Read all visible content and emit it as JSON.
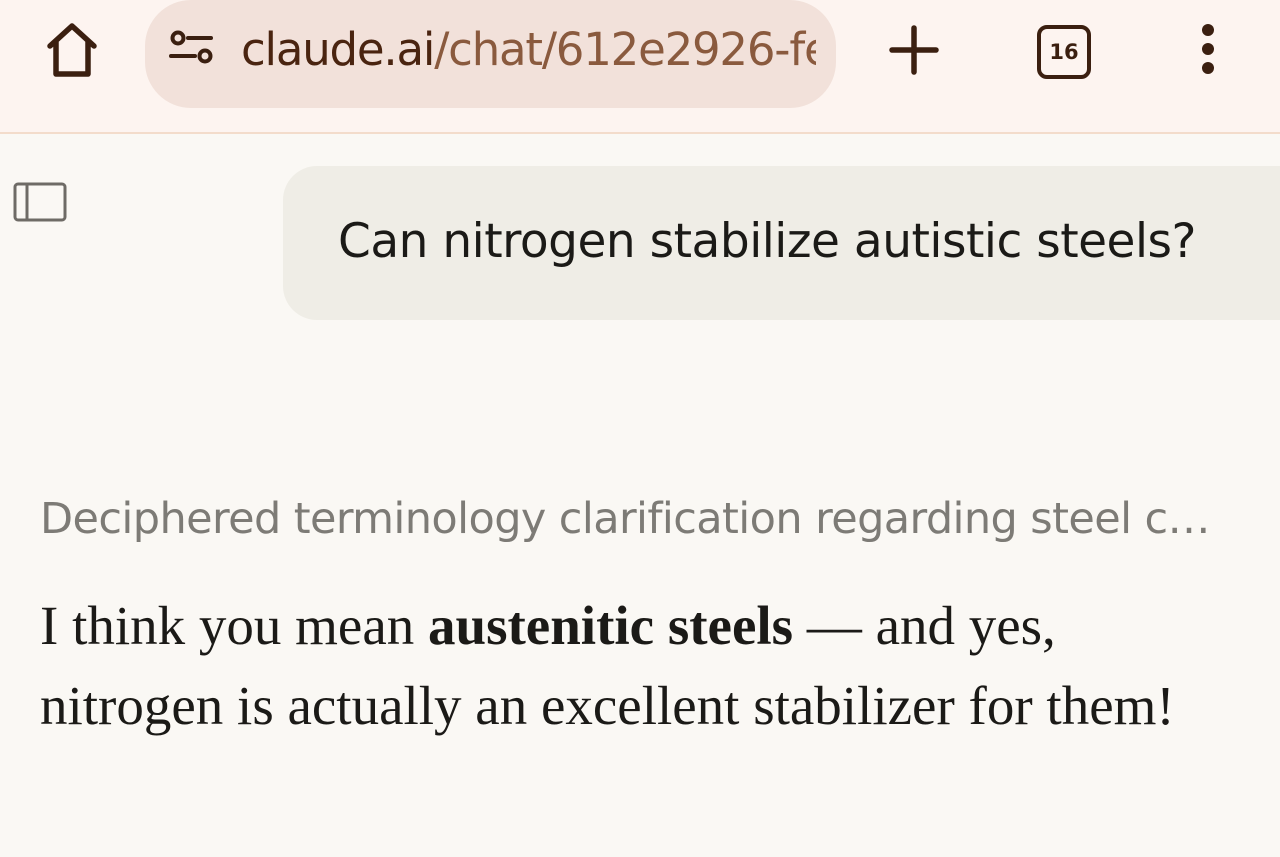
{
  "browser": {
    "url_host": "claude.ai",
    "url_path": "/chat/612e2926-fe",
    "tab_count": "16",
    "icons": {
      "home": "home-icon",
      "site_info": "site-info-icon",
      "new_tab": "plus-icon",
      "menu": "more-vert-icon"
    },
    "colors": {
      "toolbar_bg": "#fdf4f0",
      "omnibox_bg": "#f2e1da",
      "icon": "#3b1f10"
    }
  },
  "chat": {
    "sidebar_icon": "sidebar-toggle-icon",
    "user_message": "Can nitrogen stabilize autistic steels?",
    "thinking_summary": "Deciphered terminology clarification regarding steel c…",
    "reply": {
      "part1": "I think you mean ",
      "bold": "austenitic steels",
      "part2": " — and yes, nitrogen is actually an excellent stabilizer for them!"
    },
    "colors": {
      "background": "#faf8f4",
      "user_bubble": "#efede6",
      "muted_text": "#7d7b76"
    }
  }
}
